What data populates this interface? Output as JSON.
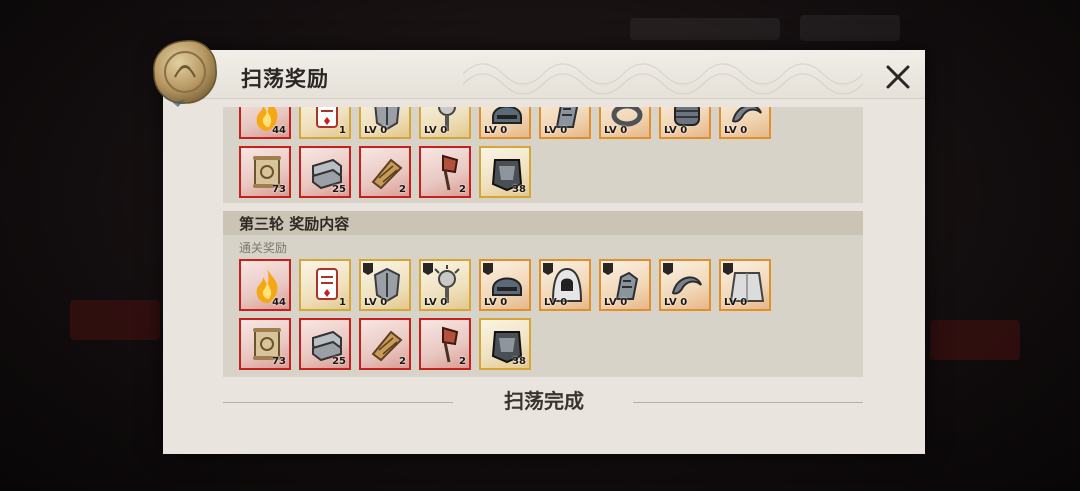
{
  "modal": {
    "title": "扫荡奖励",
    "close_icon": "close-x-icon"
  },
  "round_partial": {
    "row1": [
      {
        "icon": "flame-icon",
        "count": "44",
        "frame": "red"
      },
      {
        "icon": "ticket-icon",
        "count": "1",
        "frame": "gold"
      },
      {
        "icon": "armor-icon",
        "lv": "LV 0",
        "frame": "gold"
      },
      {
        "icon": "mace-icon",
        "lv": "LV 0",
        "frame": "gold"
      },
      {
        "icon": "helmet-icon",
        "lv": "LV 0",
        "frame": "orange"
      },
      {
        "icon": "gauntlet-icon",
        "lv": "LV 0",
        "frame": "orange"
      },
      {
        "icon": "ring-icon",
        "lv": "LV 0",
        "frame": "orange"
      },
      {
        "icon": "bracer-icon",
        "lv": "LV 0",
        "frame": "orange"
      },
      {
        "icon": "claw-icon",
        "lv": "LV 0",
        "frame": "orange"
      }
    ],
    "row2": [
      {
        "icon": "scroll-icon",
        "count": "73",
        "frame": "red"
      },
      {
        "icon": "ingot-icon",
        "count": "25",
        "frame": "red"
      },
      {
        "icon": "bellows-icon",
        "count": "2",
        "frame": "red"
      },
      {
        "icon": "axe-icon",
        "count": "2",
        "frame": "red"
      },
      {
        "icon": "chest-armor-icon",
        "count": "38",
        "frame": "gold"
      }
    ]
  },
  "round3": {
    "header": "第三轮  奖励内容",
    "sub": "通关奖励",
    "row1": [
      {
        "icon": "flame-icon",
        "count": "44",
        "frame": "red"
      },
      {
        "icon": "ticket-icon",
        "count": "1",
        "frame": "gold"
      },
      {
        "icon": "armor-icon",
        "lv": "LV 0",
        "frame": "gold"
      },
      {
        "icon": "mace-icon",
        "lv": "LV 0",
        "frame": "gold"
      },
      {
        "icon": "helmet-icon",
        "lv": "LV 0",
        "frame": "orange"
      },
      {
        "icon": "hood-icon",
        "lv": "LV 0",
        "frame": "orange"
      },
      {
        "icon": "gauntlet-icon",
        "lv": "LV 0",
        "frame": "orange"
      },
      {
        "icon": "claw-icon",
        "lv": "LV 0",
        "frame": "orange"
      },
      {
        "icon": "cloak-icon",
        "lv": "LV 0",
        "frame": "orange"
      }
    ],
    "row2": [
      {
        "icon": "scroll-icon",
        "count": "73",
        "frame": "red"
      },
      {
        "icon": "ingot-icon",
        "count": "25",
        "frame": "red"
      },
      {
        "icon": "bellows-icon",
        "count": "2",
        "frame": "red"
      },
      {
        "icon": "axe-icon",
        "count": "2",
        "frame": "red"
      },
      {
        "icon": "chest-armor-icon",
        "count": "38",
        "frame": "gold"
      }
    ]
  },
  "footer": {
    "complete_title": "扫荡完成"
  },
  "colors": {
    "frame_red": "#c6201c",
    "frame_gold": "#d5a637",
    "frame_orange": "#e0902a",
    "panel": "#e9e5de"
  }
}
